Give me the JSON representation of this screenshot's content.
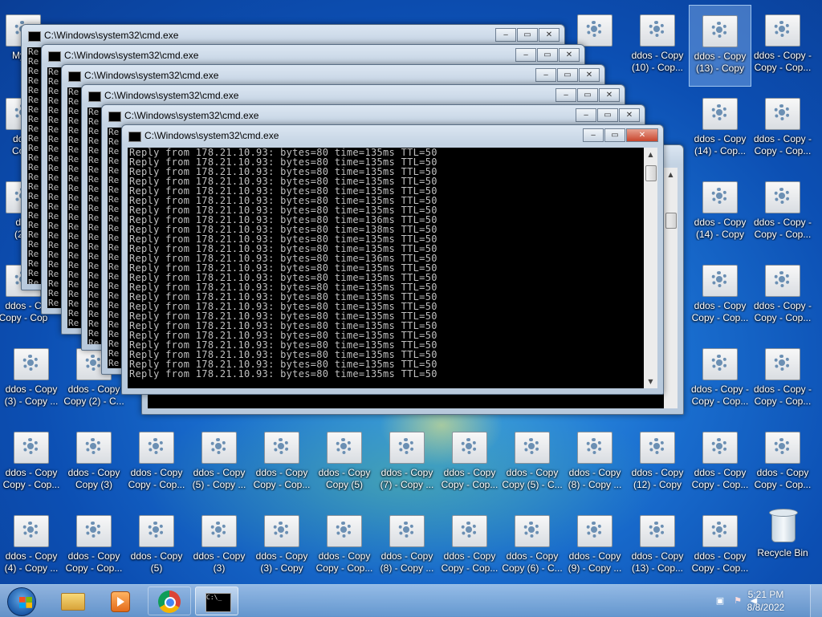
{
  "desktop": {
    "top_row_labels": [
      {
        "line1": "",
        "line2": ""
      },
      {
        "line1": "ddos - Copy",
        "line2": "(10) - Cop..."
      },
      {
        "line1": "ddos - Copy",
        "line2": "(13) - Copy"
      },
      {
        "line1": "ddos - Copy -",
        "line2": "Copy - Cop..."
      }
    ],
    "col_right1": [
      {
        "line1": "ddos - Copy",
        "line2": "(14) - Cop..."
      },
      {
        "line1": "ddos - Copy",
        "line2": "(14) - Copy"
      },
      {
        "line1": "ddos - Copy",
        "line2": "Copy - Cop..."
      },
      {
        "line1": "ddos - Copy -",
        "line2": "Copy - Cop..."
      }
    ],
    "col_right2": [
      {
        "line1": "ddos - Copy -",
        "line2": "Copy - Cop..."
      },
      {
        "line1": "ddos - Copy -",
        "line2": "Copy - Cop..."
      },
      {
        "line1": "ddos - Copy -",
        "line2": "Copy - Cop..."
      },
      {
        "line1": "ddos - Copy -",
        "line2": "Copy - Cop..."
      }
    ],
    "left_col": [
      {
        "line1": "My C",
        "line2": ""
      },
      {
        "line1": "ddos",
        "line2": "Copy"
      },
      {
        "line1": "ddc",
        "line2": "(2) -"
      },
      {
        "line1": "ddos - C",
        "line2": "Copy - Cop"
      }
    ],
    "row_mid": [
      {
        "line1": "ddos - Copy",
        "line2": "(3) - Copy ..."
      },
      {
        "line1": "ddos - Copy",
        "line2": "Copy (2) - C..."
      }
    ],
    "row_a": [
      {
        "line1": "ddos - Copy",
        "line2": "Copy - Cop..."
      },
      {
        "line1": "ddos - Copy",
        "line2": "Copy (3)"
      },
      {
        "line1": "ddos - Copy",
        "line2": "Copy - Cop..."
      },
      {
        "line1": "ddos - Copy",
        "line2": "(5) - Copy ..."
      },
      {
        "line1": "ddos - Copy",
        "line2": "Copy - Cop..."
      },
      {
        "line1": "ddos - Copy",
        "line2": "Copy (5)"
      },
      {
        "line1": "ddos - Copy",
        "line2": "(7) - Copy ..."
      },
      {
        "line1": "ddos - Copy",
        "line2": "Copy - Cop..."
      },
      {
        "line1": "ddos - Copy",
        "line2": "Copy (5) - C..."
      },
      {
        "line1": "ddos - Copy",
        "line2": "(8) - Copy ..."
      },
      {
        "line1": "ddos - Copy",
        "line2": "(12) - Copy"
      },
      {
        "line1": "ddos - Copy",
        "line2": "Copy - Cop..."
      },
      {
        "line1": "ddos - Copy",
        "line2": "Copy - Cop..."
      }
    ],
    "row_b": [
      {
        "line1": "ddos - Copy",
        "line2": "(4) - Copy ..."
      },
      {
        "line1": "ddos - Copy",
        "line2": "Copy - Cop..."
      },
      {
        "line1": "ddos - Copy",
        "line2": "(5)"
      },
      {
        "line1": "ddos - Copy",
        "line2": "(3)"
      },
      {
        "line1": "ddos - Copy",
        "line2": "(3) - Copy"
      },
      {
        "line1": "ddos - Copy",
        "line2": "Copy - Cop..."
      },
      {
        "line1": "ddos - Copy",
        "line2": "(8) - Copy ..."
      },
      {
        "line1": "ddos - Copy",
        "line2": "Copy - Cop..."
      },
      {
        "line1": "ddos - Copy",
        "line2": "Copy (6) - C..."
      },
      {
        "line1": "ddos - Copy",
        "line2": "(9) - Copy ..."
      },
      {
        "line1": "ddos - Copy",
        "line2": "(13) - Cop..."
      },
      {
        "line1": "ddos - Copy",
        "line2": "Copy - Cop..."
      }
    ],
    "recycle_bin": "Recycle Bin"
  },
  "cmd": {
    "title": "C:\\Windows\\system32\\cmd.exe",
    "back_prefix": "Re",
    "lines": [
      "Reply from 178.21.10.93: bytes=80 time=135ms TTL=50",
      "Reply from 178.21.10.93: bytes=80 time=135ms TTL=50",
      "Reply from 178.21.10.93: bytes=80 time=135ms TTL=50",
      "Reply from 178.21.10.93: bytes=80 time=135ms TTL=50",
      "Reply from 178.21.10.93: bytes=80 time=135ms TTL=50",
      "Reply from 178.21.10.93: bytes=80 time=135ms TTL=50",
      "Reply from 178.21.10.93: bytes=80 time=135ms TTL=50",
      "Reply from 178.21.10.93: bytes=80 time=136ms TTL=50",
      "Reply from 178.21.10.93: bytes=80 time=138ms TTL=50",
      "Reply from 178.21.10.93: bytes=80 time=135ms TTL=50",
      "Reply from 178.21.10.93: bytes=80 time=135ms TTL=50",
      "Reply from 178.21.10.93: bytes=80 time=136ms TTL=50",
      "Reply from 178.21.10.93: bytes=80 time=135ms TTL=50",
      "Reply from 178.21.10.93: bytes=80 time=135ms TTL=50",
      "Reply from 178.21.10.93: bytes=80 time=135ms TTL=50",
      "Reply from 178.21.10.93: bytes=80 time=135ms TTL=50",
      "Reply from 178.21.10.93: bytes=80 time=135ms TTL=50",
      "Reply from 178.21.10.93: bytes=80 time=135ms TTL=50",
      "Reply from 178.21.10.93: bytes=80 time=135ms TTL=50",
      "Reply from 178.21.10.93: bytes=80 time=135ms TTL=50",
      "Reply from 178.21.10.93: bytes=80 time=135ms TTL=50",
      "Reply from 178.21.10.93: bytes=80 time=135ms TTL=50",
      "Reply from 178.21.10.93: bytes=80 time=135ms TTL=50",
      "Reply from 178.21.10.93: bytes=80 time=135ms TTL=50"
    ],
    "behind_line": "Reply from 178.21.10.93: bytes=80 time=135ms TTL=50"
  },
  "taskbar": {
    "time": "5:21 PM",
    "date": "8/8/2022",
    "apps": [
      "explorer-icon",
      "media-player-icon",
      "chrome-icon",
      "cmd-icon"
    ]
  }
}
